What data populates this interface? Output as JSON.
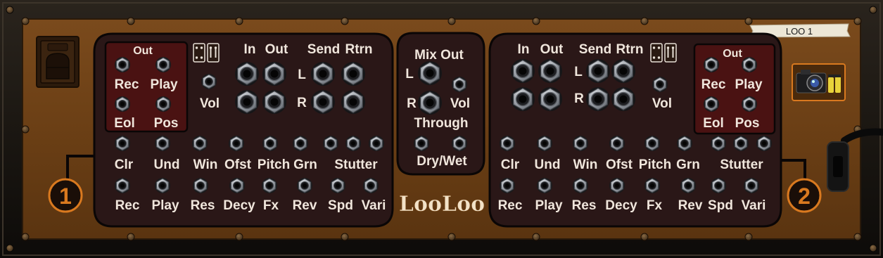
{
  "module": {
    "name_tape": "LOO 1",
    "logo": "LooLoo",
    "logo_icon": "looloo-logo",
    "power_icon": "power-switch-icon",
    "camera_icon": "camera-snapshot-icon",
    "cable_icon": "power-cable-icon",
    "sides": [
      {
        "number": "1",
        "out_group": {
          "title": "Out",
          "labels": [
            "Rec",
            "Play",
            "Eol",
            "Pos"
          ]
        },
        "vol_label": "Vol",
        "io_headers": {
          "in": "In",
          "out": "Out",
          "send": "Send",
          "rtrn": "Rtrn"
        },
        "channel_labels": {
          "left": "L",
          "right": "R"
        },
        "row1_labels": [
          "Clr",
          "Und",
          "Win",
          "Ofst",
          "Pitch",
          "Grn",
          "Stutter"
        ],
        "row2_labels": [
          "Rec",
          "Play",
          "Res",
          "Decy",
          "Fx",
          "Rev",
          "Spd",
          "Vari"
        ]
      },
      {
        "number": "2",
        "out_group": {
          "title": "Out",
          "labels": [
            "Rec",
            "Play",
            "Eol",
            "Pos"
          ]
        },
        "vol_label": "Vol",
        "io_headers": {
          "in": "In",
          "out": "Out",
          "send": "Send",
          "rtrn": "Rtrn"
        },
        "channel_labels": {
          "left": "L",
          "right": "R"
        },
        "row1_labels": [
          "Clr",
          "Und",
          "Win",
          "Ofst",
          "Pitch",
          "Grn",
          "Stutter"
        ],
        "row2_labels": [
          "Rec",
          "Play",
          "Res",
          "Decy",
          "Fx",
          "Rev",
          "Spd",
          "Vari"
        ]
      }
    ],
    "mix": {
      "title": "Mix Out",
      "left": "L",
      "right": "R",
      "vol": "Vol",
      "through": "Through",
      "drywet": "Dry/Wet"
    }
  },
  "colors": {
    "panel": "#6b4016",
    "panel_dark": "#3a220c",
    "inset": "#2a1717",
    "inset_red": "#4a1212",
    "label": "#f0e6dc",
    "badge_ring": "#d9791f",
    "jack": "#9a9fa6"
  }
}
